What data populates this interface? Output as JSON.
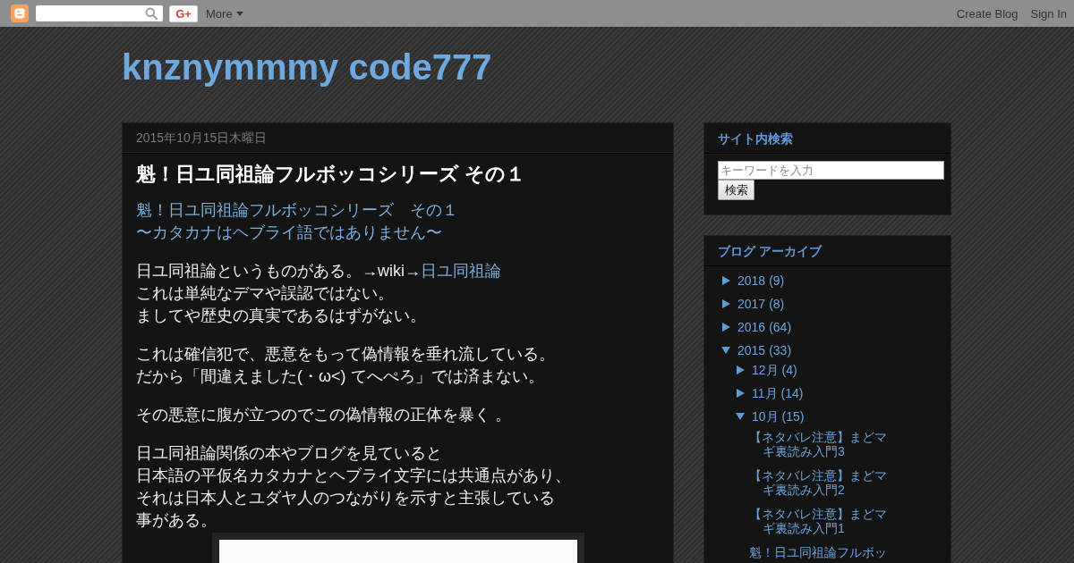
{
  "navbar": {
    "plus_button": "G+",
    "more": "More",
    "links": [
      "Create Blog",
      "Sign In"
    ]
  },
  "blog": {
    "title": "knznymmmy code777"
  },
  "post": {
    "date": "2015年10月15日木曜日",
    "title": "魁！日ユ同祖論フルボッコシリーズ その１",
    "paragraphs": [
      {
        "kind": "subtitle",
        "lines": [
          {
            "text": "魁！日ユ同祖論フルボッコシリーズ　その１"
          },
          {
            "text": "〜カタカナはヘブライ語ではありません〜"
          }
        ]
      },
      {
        "kind": "text",
        "lines": [
          {
            "text": "日ユ同祖論というものがある。→wiki→",
            "link": "日ユ同祖論"
          },
          {
            "text": "これは単純なデマや誤認ではない。"
          },
          {
            "text": "ましてや歴史の真実であるはずがない。"
          }
        ]
      },
      {
        "kind": "text",
        "lines": [
          {
            "text": "これは確信犯で、悪意をもって偽情報を垂れ流している。"
          },
          {
            "text": "だから「間違えました(・ω<) てへぺろ」では済まない。"
          }
        ]
      },
      {
        "kind": "text",
        "lines": [
          {
            "text": "その悪意に腹が立つのでこの偽情報の正体を暴く 。"
          }
        ]
      },
      {
        "kind": "text",
        "lines": [
          {
            "text": "日ユ同祖論関係の本やブログを見ていると"
          },
          {
            "text": "日本語の平仮名カタカナとヘブライ文字には共通点があり、"
          },
          {
            "text": "それは日本人とユダヤ人のつながりを示すと主張している"
          },
          {
            "text": "事がある。"
          }
        ]
      }
    ]
  },
  "sidebar": {
    "search_widget": {
      "title": "サイト内検索",
      "placeholder": "キーワードを入力",
      "button": "検索"
    },
    "archive": {
      "title": "ブログ アーカイブ",
      "items": [
        {
          "label": "2018",
          "count": "(9)",
          "expanded": false
        },
        {
          "label": "2017",
          "count": "(8)",
          "expanded": false
        },
        {
          "label": "2016",
          "count": "(64)",
          "expanded": false
        },
        {
          "label": "2015",
          "count": "(33)",
          "expanded": true,
          "children": [
            {
              "label": "12月",
              "count": "(4)",
              "expanded": false
            },
            {
              "label": "11月",
              "count": "(14)",
              "expanded": false
            },
            {
              "label": "10月",
              "count": "(15)",
              "expanded": true,
              "children": [
                {
                  "title": "【ネタバレ注意】まどマギ裏読み入門3"
                },
                {
                  "title": "【ネタバレ注意】まどマギ裏読み入門2"
                },
                {
                  "title": "【ネタバレ注意】まどマギ裏読み入門1"
                },
                {
                  "title": "魁！日ユ同祖論フルボッ"
                }
              ]
            }
          ]
        }
      ]
    }
  }
}
